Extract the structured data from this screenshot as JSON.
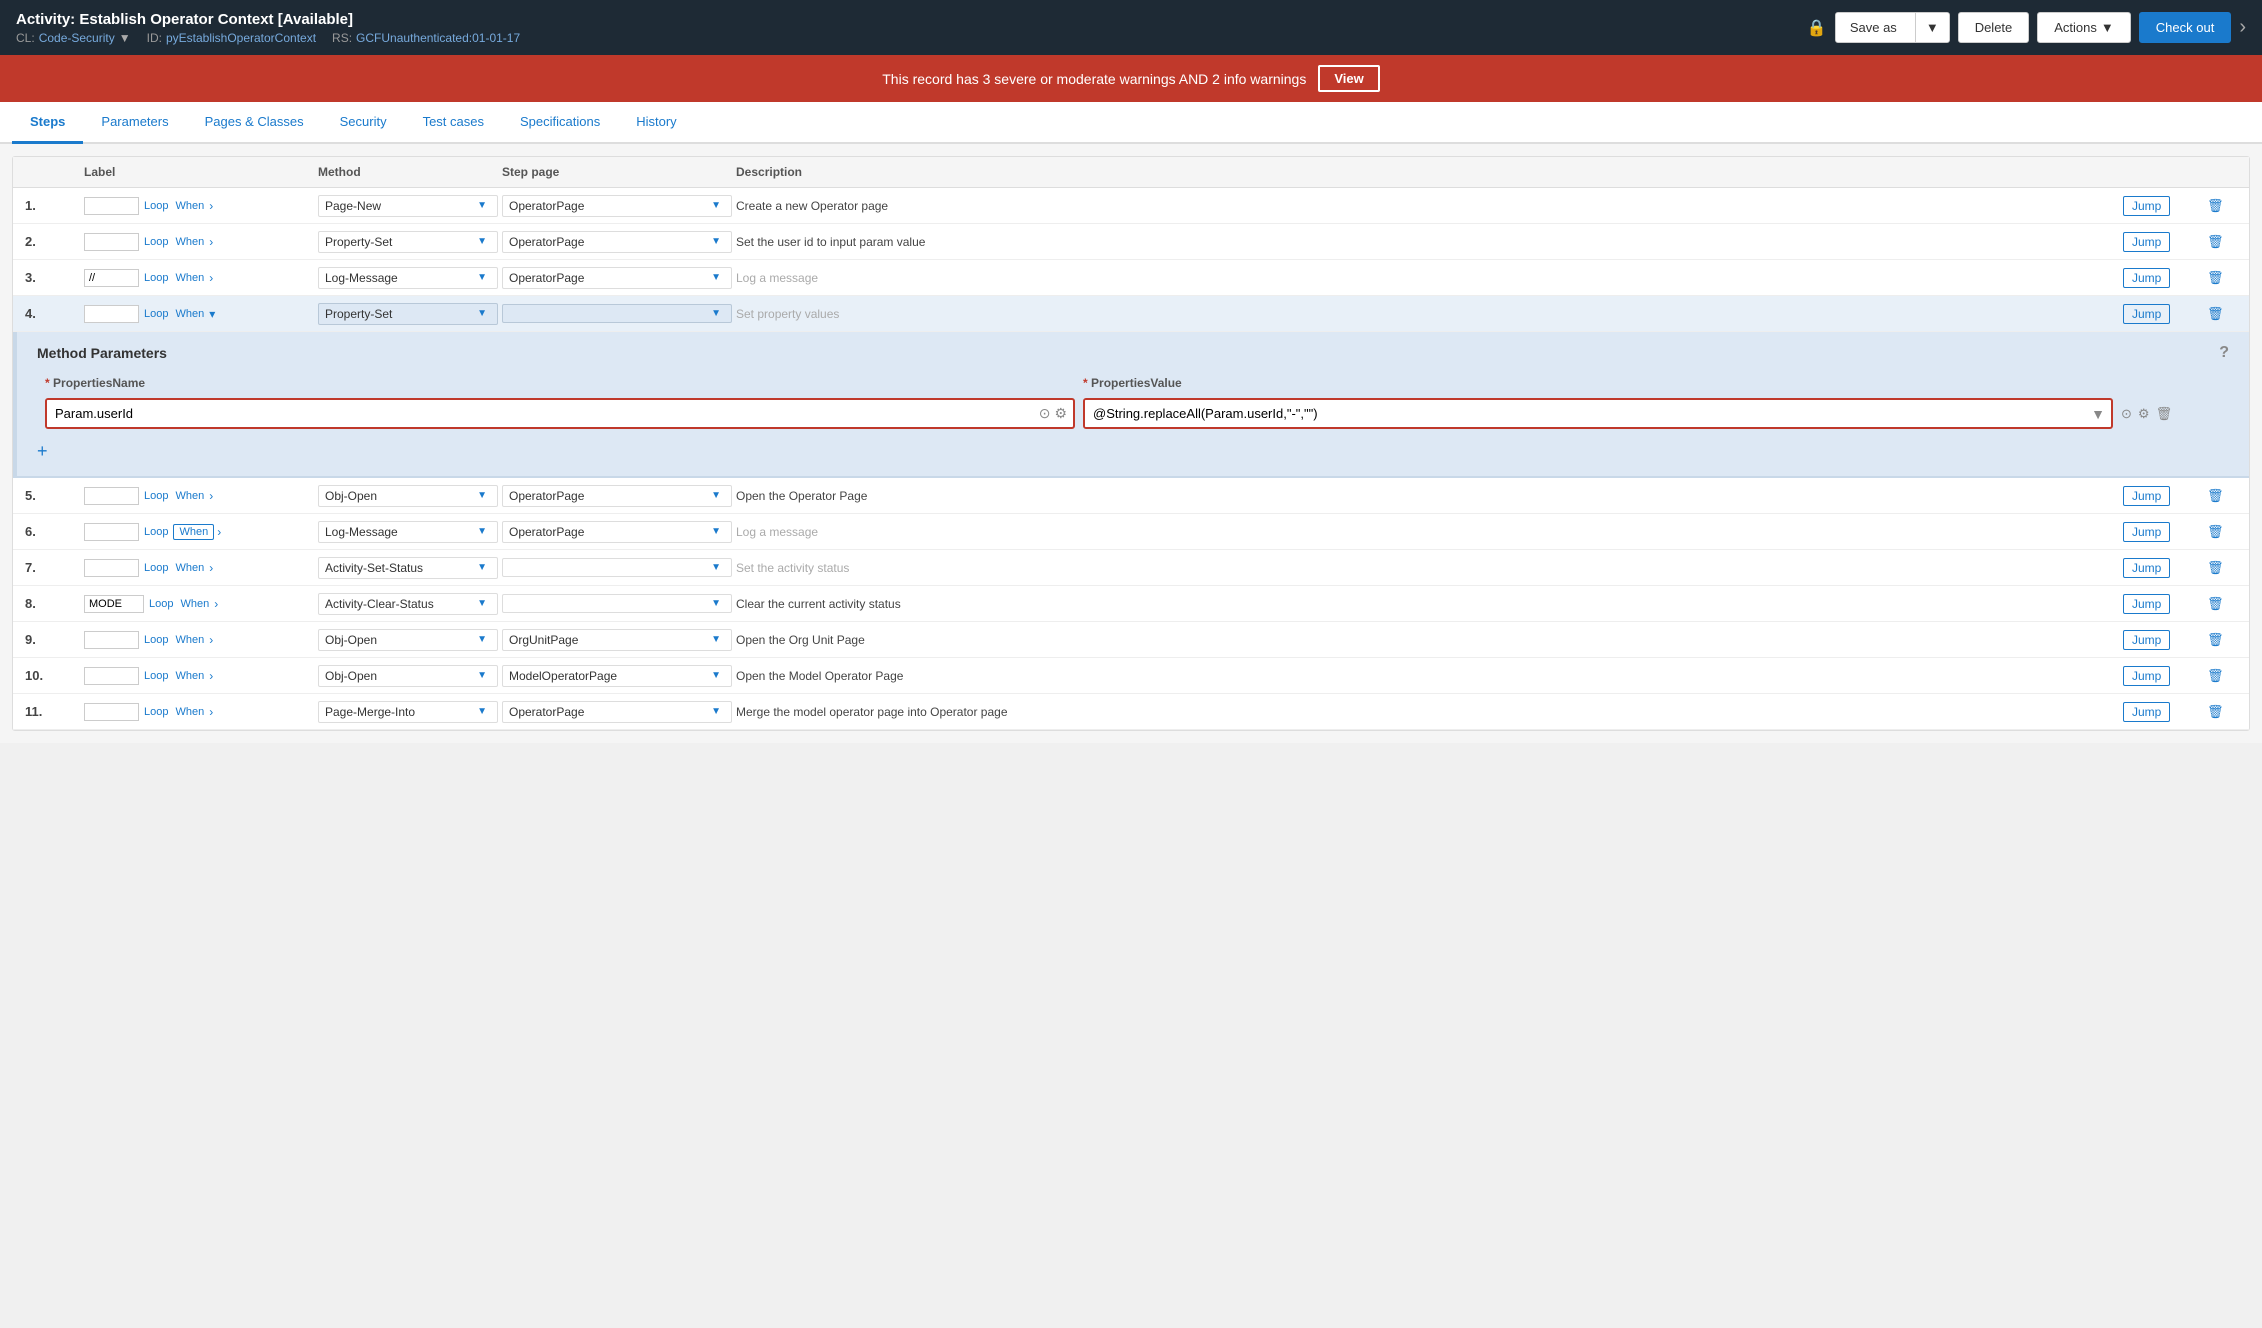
{
  "header": {
    "title": "Activity: Establish Operator Context [Available]",
    "cl_label": "CL:",
    "cl_value": "Code-Security",
    "id_label": "ID:",
    "id_value": "pyEstablishOperatorContext",
    "rs_label": "RS:",
    "rs_value": "GCFUnauthenticated:01-01-17",
    "save_as_label": "Save as",
    "delete_label": "Delete",
    "actions_label": "Actions",
    "checkout_label": "Check out"
  },
  "warning": {
    "text": "This record has 3 severe or moderate warnings AND 2 info warnings",
    "view_label": "View"
  },
  "tabs": [
    {
      "label": "Steps",
      "active": true
    },
    {
      "label": "Parameters",
      "active": false
    },
    {
      "label": "Pages & Classes",
      "active": false
    },
    {
      "label": "Security",
      "active": false
    },
    {
      "label": "Test cases",
      "active": false
    },
    {
      "label": "Specifications",
      "active": false
    },
    {
      "label": "History",
      "active": false
    }
  ],
  "table": {
    "columns": {
      "label": "Label",
      "method": "Method",
      "steppage": "Step page",
      "description": "Description"
    }
  },
  "steps": [
    {
      "num": "1.",
      "label": "",
      "loop": "Loop",
      "when": "When",
      "expanded_arrow": false,
      "method": "Page-New",
      "steppage": "OperatorPage",
      "description": "Create a new Operator page",
      "desc_placeholder": false,
      "jump": "Jump"
    },
    {
      "num": "2.",
      "label": "",
      "loop": "Loop",
      "when": "When",
      "expanded_arrow": false,
      "method": "Property-Set",
      "steppage": "OperatorPage",
      "description": "Set the user id to input param value",
      "desc_placeholder": false,
      "jump": "Jump"
    },
    {
      "num": "3.",
      "label": "//",
      "loop": "Loop",
      "when": "When",
      "expanded_arrow": false,
      "method": "Log-Message",
      "steppage": "OperatorPage",
      "description": "Log a message",
      "desc_placeholder": true,
      "jump": "Jump"
    },
    {
      "num": "4.",
      "label": "",
      "loop": "Loop",
      "when": "When",
      "expanded_arrow": true,
      "method": "Property-Set",
      "steppage": "",
      "description": "Set property values",
      "desc_placeholder": true,
      "jump": "Jump",
      "has_params": true
    }
  ],
  "method_params": {
    "title": "Method Parameters",
    "col_name": "PropertiesName",
    "col_value": "PropertiesValue",
    "required_marker": "*",
    "rows": [
      {
        "name": "Param.userId",
        "value": "@String.replaceAll(Param.userId,\"-\",\"\")"
      }
    ],
    "add_label": "+"
  },
  "steps_after": [
    {
      "num": "5.",
      "label": "",
      "loop": "Loop",
      "when": "When",
      "expanded_arrow": false,
      "method": "Obj-Open",
      "steppage": "OperatorPage",
      "description": "Open the Operator Page",
      "desc_placeholder": false,
      "jump": "Jump"
    },
    {
      "num": "6.",
      "label": "",
      "loop": "Loop",
      "when": "When",
      "expanded_arrow": false,
      "method": "Log-Message",
      "steppage": "OperatorPage",
      "description": "Log a message",
      "desc_placeholder": true,
      "when_boxed": true,
      "jump": "Jump"
    },
    {
      "num": "7.",
      "label": "",
      "loop": "Loop",
      "when": "When",
      "expanded_arrow": false,
      "method": "Activity-Set-Status",
      "steppage": "",
      "description": "Set the activity status",
      "desc_placeholder": true,
      "jump": "Jump"
    },
    {
      "num": "8.",
      "label": "MODE",
      "loop": "Loop",
      "when": "When",
      "expanded_arrow": false,
      "method": "Activity-Clear-Status",
      "steppage": "",
      "description": "Clear the current activity status",
      "desc_placeholder": false,
      "jump": "Jump"
    },
    {
      "num": "9.",
      "label": "",
      "loop": "Loop",
      "when": "When",
      "expanded_arrow": false,
      "method": "Obj-Open",
      "steppage": "OrgUnitPage",
      "description": "Open the Org Unit Page",
      "desc_placeholder": false,
      "jump": "Jump"
    },
    {
      "num": "10.",
      "label": "",
      "loop": "Loop",
      "when": "When",
      "expanded_arrow": false,
      "method": "Obj-Open",
      "steppage": "ModelOperatorPage",
      "description": "Open the Model Operator Page",
      "desc_placeholder": false,
      "jump": "Jump"
    },
    {
      "num": "11.",
      "label": "",
      "loop": "Loop",
      "when": "When",
      "expanded_arrow": false,
      "method": "Page-Merge-Into",
      "steppage": "OperatorPage",
      "description": "Merge the model operator page into Operator page",
      "desc_placeholder": false,
      "jump": "Jump"
    }
  ]
}
